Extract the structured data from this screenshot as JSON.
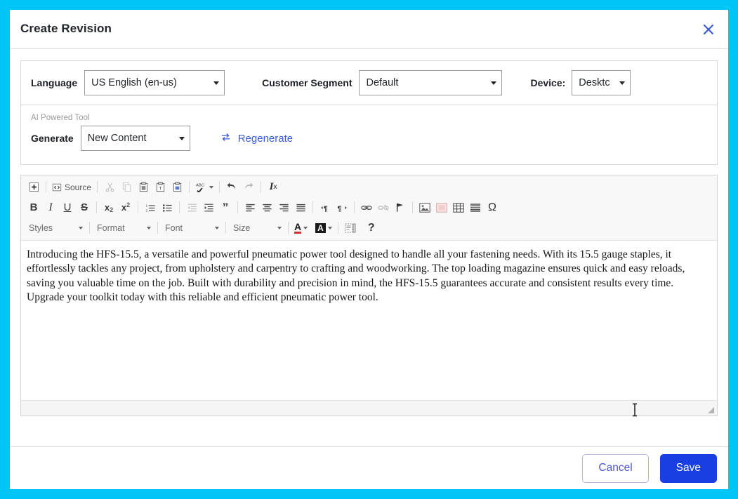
{
  "theme": {
    "page_border_color": "#00c6f7",
    "accent_blue": "#1a3fe0",
    "link_blue": "#3b5bdb"
  },
  "header": {
    "title": "Create Revision",
    "close_icon": "close-icon"
  },
  "form": {
    "language": {
      "label": "Language",
      "value": "US English (en-us)"
    },
    "customer_segment": {
      "label": "Customer Segment",
      "value": "Default"
    },
    "device": {
      "label": "Device:",
      "value": "Desktc"
    }
  },
  "ai_tool": {
    "section_label": "AI Powered Tool",
    "generate": {
      "label": "Generate",
      "value": "New Content"
    },
    "regenerate": {
      "label": "Regenerate",
      "icon": "refresh-icon"
    }
  },
  "editor": {
    "toolbar_row1": [
      {
        "name": "maximize-button",
        "glyph": "+"
      },
      {
        "name": "source-button",
        "glyph": "Source"
      },
      {
        "name": "cut-button",
        "glyph": "cut"
      },
      {
        "name": "copy-button",
        "glyph": "copy"
      },
      {
        "name": "paste-button",
        "glyph": "paste"
      },
      {
        "name": "paste-as-text-button",
        "glyph": "paste-text"
      },
      {
        "name": "paste-from-word-button",
        "glyph": "paste-word"
      },
      {
        "name": "spell-check-button",
        "glyph": "ABC"
      },
      {
        "name": "undo-button",
        "glyph": "undo"
      },
      {
        "name": "redo-button",
        "glyph": "redo"
      },
      {
        "name": "remove-format-button",
        "glyph": "Ix"
      }
    ],
    "toolbar_row2": [
      {
        "name": "bold-button",
        "glyph": "B"
      },
      {
        "name": "italic-button",
        "glyph": "I"
      },
      {
        "name": "underline-button",
        "glyph": "U"
      },
      {
        "name": "strikethrough-button",
        "glyph": "S"
      },
      {
        "name": "subscript-button",
        "glyph": "x2"
      },
      {
        "name": "superscript-button",
        "glyph": "x2"
      },
      {
        "name": "numbered-list-button",
        "glyph": "ol"
      },
      {
        "name": "bulleted-list-button",
        "glyph": "ul"
      },
      {
        "name": "decrease-indent-button",
        "glyph": "outdent"
      },
      {
        "name": "increase-indent-button",
        "glyph": "indent"
      },
      {
        "name": "blockquote-button",
        "glyph": "”"
      },
      {
        "name": "align-left-button",
        "glyph": "align-left"
      },
      {
        "name": "align-center-button",
        "glyph": "align-center"
      },
      {
        "name": "align-right-button",
        "glyph": "align-right"
      },
      {
        "name": "align-justify-button",
        "glyph": "align-justify"
      },
      {
        "name": "text-direction-ltr-button",
        "glyph": "ltr"
      },
      {
        "name": "text-direction-rtl-button",
        "glyph": "rtl"
      },
      {
        "name": "link-button",
        "glyph": "link"
      },
      {
        "name": "unlink-button",
        "glyph": "unlink"
      },
      {
        "name": "anchor-button",
        "glyph": "flag"
      },
      {
        "name": "image-button",
        "glyph": "image"
      },
      {
        "name": "flash-button",
        "glyph": "flash"
      },
      {
        "name": "table-button",
        "glyph": "table"
      },
      {
        "name": "horizontal-rule-button",
        "glyph": "hr"
      },
      {
        "name": "special-character-button",
        "glyph": "Ω"
      }
    ],
    "toolbar_row3": {
      "styles": "Styles",
      "format": "Format",
      "font": "Font",
      "size": "Size",
      "text_color": "text-color-button",
      "background_color": "background-color-button",
      "show_blocks": "show-blocks-button",
      "help": "?"
    },
    "content": "Introducing the HFS-15.5, a versatile and powerful pneumatic power tool designed to handle all your fastening needs. With its 15.5 gauge staples, it effortlessly tackles any project, from upholstery and carpentry to crafting and woodworking. The top loading magazine ensures quick and easy reloads, saving you valuable time on the job. Built with durability and precision in mind, the HFS-15.5 guarantees accurate and consistent results every time. Upgrade your toolkit today with this reliable and efficient pneumatic power tool."
  },
  "footer": {
    "cancel_label": "Cancel",
    "save_label": "Save"
  }
}
